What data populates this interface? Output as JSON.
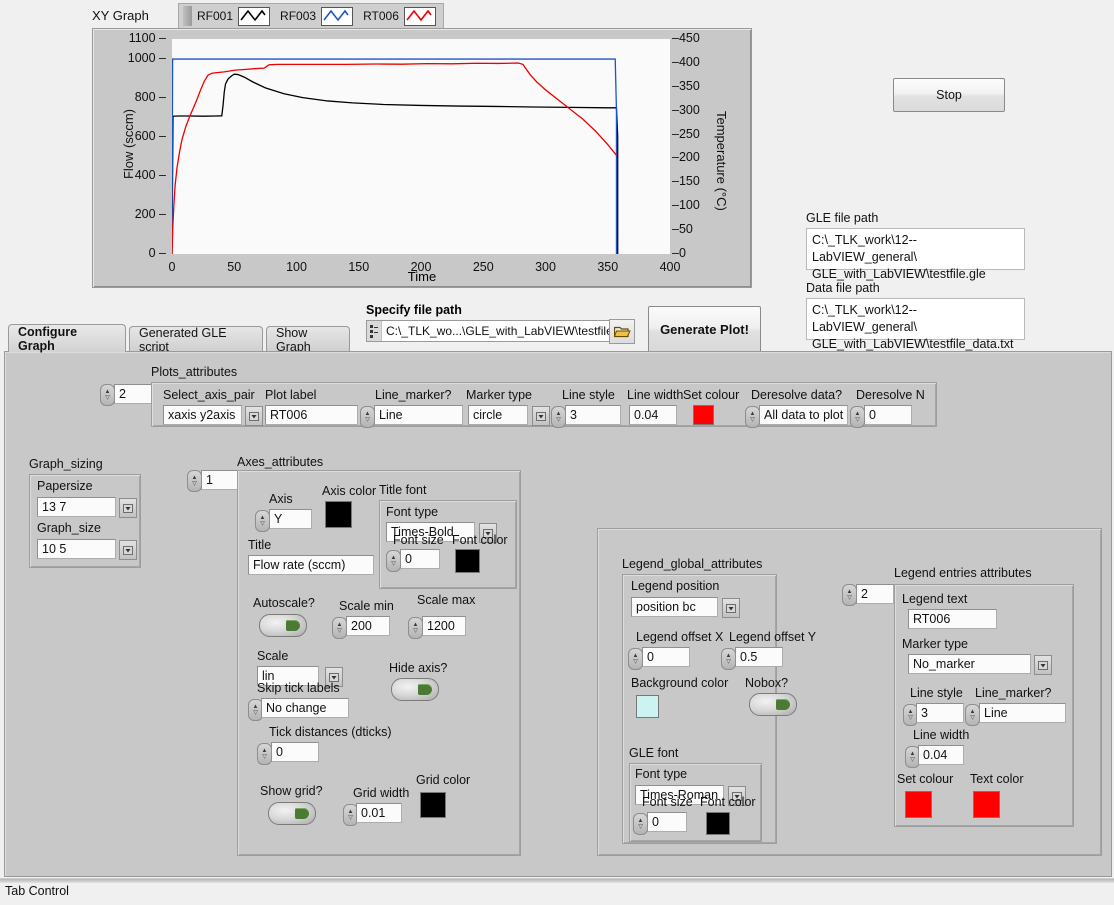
{
  "graph": {
    "title": "XY Graph",
    "plot_legend": [
      {
        "name": "RF001",
        "color": "#000000"
      },
      {
        "name": "RF003",
        "color": "#1c54c8"
      },
      {
        "name": "RT006",
        "color": "#ee0000"
      }
    ],
    "y_label": "Flow (sccm)",
    "y2_label": "Temperature (°C)",
    "x_label": "Time",
    "y_ticks": [
      "1100",
      "1000",
      "800",
      "600",
      "400",
      "200",
      "0"
    ],
    "y2_ticks": [
      "450",
      "400",
      "350",
      "300",
      "250",
      "200",
      "150",
      "100",
      "50",
      "0"
    ],
    "x_ticks": [
      "0",
      "50",
      "100",
      "150",
      "200",
      "250",
      "300",
      "350",
      "400"
    ]
  },
  "chart_data": {
    "type": "line",
    "title": "XY Graph",
    "xlabel": "Time",
    "ylabel": "Flow (sccm)",
    "y2label": "Temperature (°C)",
    "xlim": [
      0,
      400
    ],
    "ylim": [
      0,
      1100
    ],
    "y2lim": [
      0,
      450
    ],
    "grid": false,
    "legend_position": "top",
    "series": [
      {
        "name": "RF001",
        "color": "#000000",
        "axis": "left",
        "points": [
          [
            0,
            0
          ],
          [
            0.8,
            705
          ],
          [
            5,
            706
          ],
          [
            15,
            706
          ],
          [
            25,
            705
          ],
          [
            35,
            706
          ],
          [
            40,
            707
          ],
          [
            41,
            760
          ],
          [
            42,
            830
          ],
          [
            43,
            870
          ],
          [
            45,
            895
          ],
          [
            48,
            912
          ],
          [
            50,
            920
          ],
          [
            53,
            918
          ],
          [
            58,
            905
          ],
          [
            65,
            880
          ],
          [
            75,
            850
          ],
          [
            90,
            820
          ],
          [
            105,
            800
          ],
          [
            125,
            783
          ],
          [
            145,
            773
          ],
          [
            170,
            765
          ],
          [
            200,
            760
          ],
          [
            230,
            757
          ],
          [
            260,
            755
          ],
          [
            290,
            752
          ],
          [
            320,
            750
          ],
          [
            350,
            748
          ],
          [
            357,
            748
          ],
          [
            358,
            600
          ],
          [
            358,
            300
          ],
          [
            358,
            0
          ]
        ]
      },
      {
        "name": "RF003",
        "color": "#1c54c8",
        "axis": "right",
        "points": [
          [
            0,
            0
          ],
          [
            0.5,
            408
          ],
          [
            20,
            408
          ],
          [
            60,
            408
          ],
          [
            120,
            408
          ],
          [
            200,
            408
          ],
          [
            280,
            408
          ],
          [
            340,
            408
          ],
          [
            356,
            408
          ],
          [
            357,
            300
          ],
          [
            357,
            150
          ],
          [
            357,
            0
          ]
        ]
      },
      {
        "name": "RT006",
        "color": "#ee0000",
        "axis": "left",
        "points": [
          [
            0,
            0
          ],
          [
            0.6,
            130
          ],
          [
            1.5,
            250
          ],
          [
            2.5,
            350
          ],
          [
            4,
            440
          ],
          [
            6,
            520
          ],
          [
            8,
            585
          ],
          [
            11,
            650
          ],
          [
            14,
            700
          ],
          [
            17,
            745
          ],
          [
            20,
            790
          ],
          [
            23,
            840
          ],
          [
            26,
            885
          ],
          [
            29,
            915
          ],
          [
            32,
            925
          ],
          [
            36,
            928
          ],
          [
            42,
            932
          ],
          [
            50,
            940
          ],
          [
            58,
            944
          ],
          [
            66,
            948
          ],
          [
            74,
            951
          ],
          [
            78,
            968
          ],
          [
            85,
            970
          ],
          [
            110,
            970
          ],
          [
            140,
            970
          ],
          [
            165,
            972
          ],
          [
            185,
            971
          ],
          [
            205,
            974
          ],
          [
            225,
            973
          ],
          [
            245,
            976
          ],
          [
            262,
            975
          ],
          [
            278,
            977
          ],
          [
            282,
            970
          ],
          [
            284,
            950
          ],
          [
            288,
            915
          ],
          [
            293,
            880
          ],
          [
            300,
            840
          ],
          [
            310,
            790
          ],
          [
            320,
            740
          ],
          [
            330,
            690
          ],
          [
            340,
            630
          ],
          [
            350,
            560
          ],
          [
            357,
            505
          ]
        ]
      }
    ]
  },
  "stop_button": {
    "label": "Stop"
  },
  "gle_file": {
    "label": "GLE file path",
    "line1": "C:\\_TLK_work\\12--LabVIEW_general\\",
    "line2": "GLE_with_LabVIEW\\testfile.gle"
  },
  "data_file": {
    "label": "Data file path",
    "line1": "C:\\_TLK_work\\12--LabVIEW_general\\",
    "line2": "GLE_with_LabVIEW\\testfile_data.txt"
  },
  "specify_path": {
    "label": "Specify file path",
    "value": "C:\\_TLK_wo...\\GLE_with_LabVIEW\\testfile"
  },
  "generate_button": {
    "label": "Generate Plot!"
  },
  "tabs": [
    {
      "label": "Configure Graph",
      "active": true
    },
    {
      "label": "Generated GLE script",
      "active": false
    },
    {
      "label": "Show Graph",
      "active": false
    }
  ],
  "plots_attributes": {
    "group_label": "Plots_attributes",
    "index": "2",
    "select_axis_pair": {
      "label": "Select_axis_pair",
      "value": "xaxis y2axis"
    },
    "plot_label": {
      "label": "Plot label",
      "value": "RT006"
    },
    "line_marker": {
      "label": "Line_marker?",
      "value": "Line"
    },
    "marker_type": {
      "label": "Marker type",
      "value": "circle"
    },
    "line_style": {
      "label": "Line style",
      "value": "3"
    },
    "line_width": {
      "label": "Line width",
      "value": "0.04"
    },
    "set_colour": {
      "label": "Set colour",
      "color": "#ff0000"
    },
    "deresolve_data": {
      "label": "Deresolve data?",
      "value": "All data to plot"
    },
    "deresolve_n": {
      "label": "Deresolve N",
      "value": "0"
    }
  },
  "graph_sizing": {
    "group_label": "Graph_sizing",
    "papersize": {
      "label": "Papersize",
      "value": "13 7"
    },
    "graph_size": {
      "label": "Graph_size",
      "value": "10 5"
    }
  },
  "axes_attributes": {
    "group_label": "Axes_attributes",
    "index": "1",
    "axis": {
      "label": "Axis",
      "value": "Y"
    },
    "axis_color": {
      "label": "Axis color",
      "color": "#000000"
    },
    "title_font": {
      "group_label": "Title font",
      "font_type": {
        "label": "Font type",
        "value": "Times-Bold"
      },
      "font_size": {
        "label": "Font size",
        "value": "0"
      },
      "font_color": {
        "label": "Font color",
        "color": "#000000"
      }
    },
    "title": {
      "label": "Title",
      "value": "Flow rate (sccm)"
    },
    "autoscale": {
      "label": "Autoscale?"
    },
    "scale_min": {
      "label": "Scale min",
      "value": "200"
    },
    "scale_max": {
      "label": "Scale max",
      "value": "1200"
    },
    "scale": {
      "label": "Scale",
      "value": "lin"
    },
    "hide_axis": {
      "label": "Hide axis?"
    },
    "skip_tick_labels": {
      "label": "Skip tick labels",
      "value": "No change"
    },
    "tick_distances": {
      "label": "Tick distances (dticks)",
      "value": "0"
    },
    "show_grid": {
      "label": "Show grid?"
    },
    "grid_width": {
      "label": "Grid width",
      "value": "0.01"
    },
    "grid_color": {
      "label": "Grid color",
      "color": "#000000"
    }
  },
  "legend_global": {
    "group_label": "Legend_global_attributes",
    "legend_position": {
      "label": "Legend position",
      "value": "position bc"
    },
    "legend_offset_x": {
      "label": "Legend offset X",
      "value": "0"
    },
    "legend_offset_y": {
      "label": "Legend offset Y",
      "value": "0.5"
    },
    "background_color": {
      "label": "Background color",
      "color": "#cdf2f2"
    },
    "nobox": {
      "label": "Nobox?"
    },
    "gle_font": {
      "group_label": "GLE font",
      "font_type": {
        "label": "Font type",
        "value": "Times-Roman"
      },
      "font_size": {
        "label": "Font size",
        "value": "0"
      },
      "font_color": {
        "label": "Font color",
        "color": "#000000"
      }
    }
  },
  "legend_entries": {
    "group_label": "Legend entries attributes",
    "index": "2",
    "legend_text": {
      "label": "Legend text",
      "value": "RT006"
    },
    "marker_type": {
      "label": "Marker type",
      "value": "No_marker"
    },
    "line_style": {
      "label": "Line style",
      "value": "3"
    },
    "line_marker": {
      "label": "Line_marker?",
      "value": "Line"
    },
    "line_width": {
      "label": "Line width",
      "value": "0.04"
    },
    "set_colour": {
      "label": "Set colour",
      "color": "#ff0000"
    },
    "text_color": {
      "label": "Text color",
      "color": "#ff0000"
    }
  },
  "status_bar": {
    "text": "Tab Control"
  }
}
